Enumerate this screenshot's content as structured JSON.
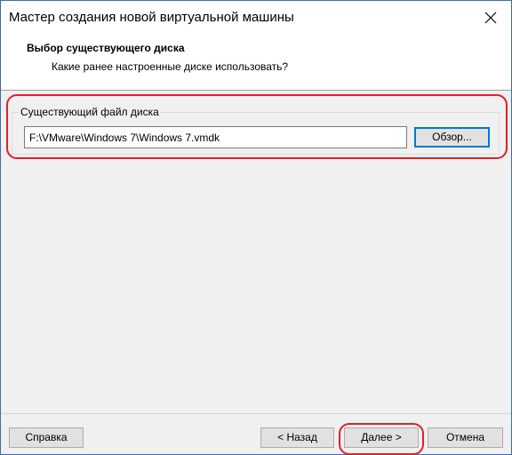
{
  "window": {
    "title": "Мастер создания новой виртуальной машины"
  },
  "header": {
    "title": "Выбор существующего диска",
    "subtitle": "Какие ранее настроенные диске использовать?"
  },
  "disk_group": {
    "label": "Существующий файл диска",
    "path_value": "F:\\VMware\\Windows 7\\Windows 7.vmdk",
    "browse_label": "Обзор..."
  },
  "footer": {
    "help_label": "Справка",
    "back_label": "< Назад",
    "next_label": "Далее >",
    "cancel_label": "Отмена"
  },
  "colors": {
    "highlight": "#e0202a",
    "default_button_border": "#0078d7",
    "window_border": "#3c6ea8"
  },
  "icons": {
    "close": "close-icon"
  }
}
